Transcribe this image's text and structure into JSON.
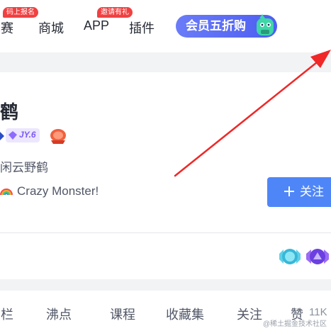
{
  "nav": {
    "items": [
      {
        "label": "竞赛",
        "badge": "码上报名"
      },
      {
        "label": "商城",
        "badge": ""
      },
      {
        "label": "APP",
        "badge": "邀请有礼"
      },
      {
        "label": "插件",
        "badge": ""
      }
    ],
    "vip_label": "会员五折购",
    "vip_icon": "mascot-icon"
  },
  "profile": {
    "name_visible": "鹤",
    "level_badge": "JY.6",
    "description": "闲云野鹤",
    "motto": "Crazy Monster!",
    "motto_icon": "rainbow-icon",
    "follow_label": "关注",
    "follow_icon": "plus-icon"
  },
  "tabs": {
    "items": [
      "专栏",
      "沸点",
      "课程",
      "收藏集",
      "关注",
      "赞"
    ],
    "likes_count": "11K"
  },
  "watermark": "@稀土掘金技术社区",
  "colors": {
    "accent": "#4f86f7",
    "badge_red": "#f04142",
    "vip_gradient_start": "#6a7cf8",
    "arrow_red": "#f02828"
  }
}
